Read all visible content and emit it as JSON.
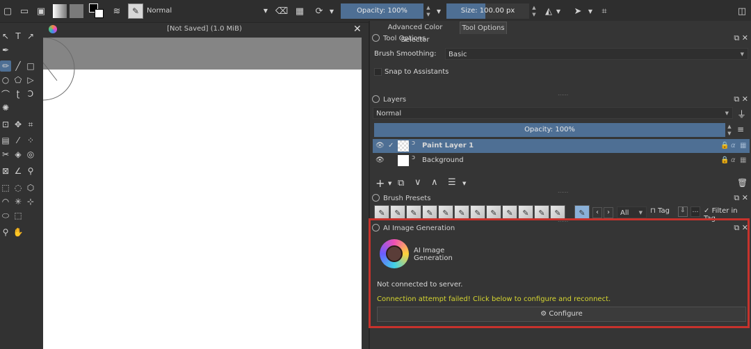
{
  "toolbar": {
    "blend_mode": "Normal",
    "opacity": "Opacity: 100%",
    "size": "Size: 100.00 px",
    "size_fraction": 0.47
  },
  "document": {
    "title": "[Not Saved]  (1.0 MiB)"
  },
  "docker": {
    "tabs": [
      "Advanced Color Selector",
      "Tool Options"
    ],
    "tool_options": {
      "title": "Tool Options",
      "brush_smoothing_label": "Brush Smoothing:",
      "brush_smoothing_value": "Basic",
      "snap_label": "Snap to Assistants"
    },
    "layers": {
      "title": "Layers",
      "blend_mode": "Normal",
      "opacity": "Opacity:  100%",
      "items": [
        {
          "name": "Paint Layer 1",
          "selected": true
        },
        {
          "name": "Background",
          "selected": false
        }
      ]
    },
    "brush_presets": {
      "title": "Brush Presets",
      "filter_value": "All",
      "tag_label": "Tag",
      "filter_in_tag": "Filter in Tag"
    },
    "ai": {
      "title": "AI Image Generation",
      "plugin_name_line1": "AI Image",
      "plugin_name_line2": "Generation",
      "status": "Not connected to server.",
      "error": "Connection attempt failed! Click below to configure and reconnect.",
      "configure_label": "Configure",
      "error_color": "#d6d631",
      "highlight_color": "#c7322c"
    }
  },
  "colors": {
    "accent": "#4e6f94",
    "background": "#323232"
  }
}
